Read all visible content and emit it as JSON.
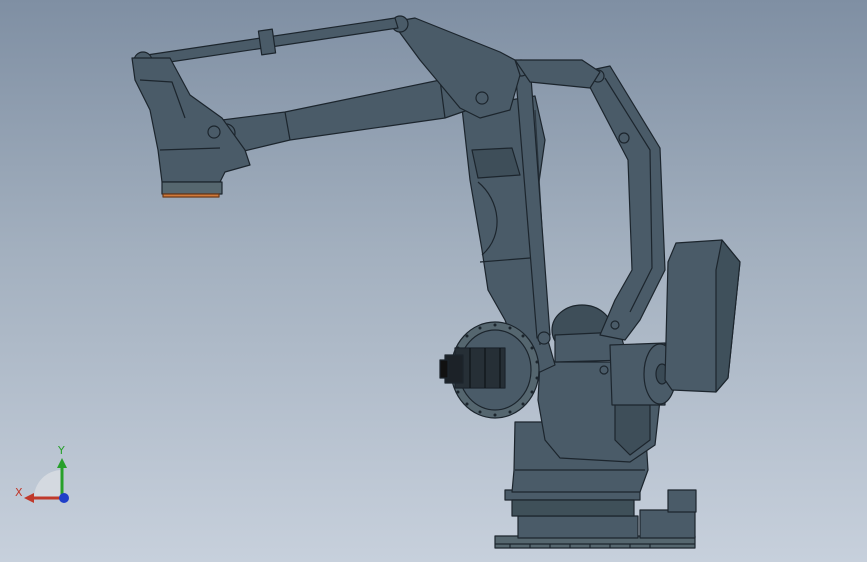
{
  "viewport": {
    "background_top": "#7f8fa3",
    "background_bottom": "#c7d0dc",
    "model_color": "#4a5b68",
    "model_edge_color": "#1c252d"
  },
  "triad": {
    "x_label": "X",
    "y_label": "Y",
    "x_color": "#c0392b",
    "y_color": "#27a02a",
    "z_color": "#1f3fc9"
  }
}
